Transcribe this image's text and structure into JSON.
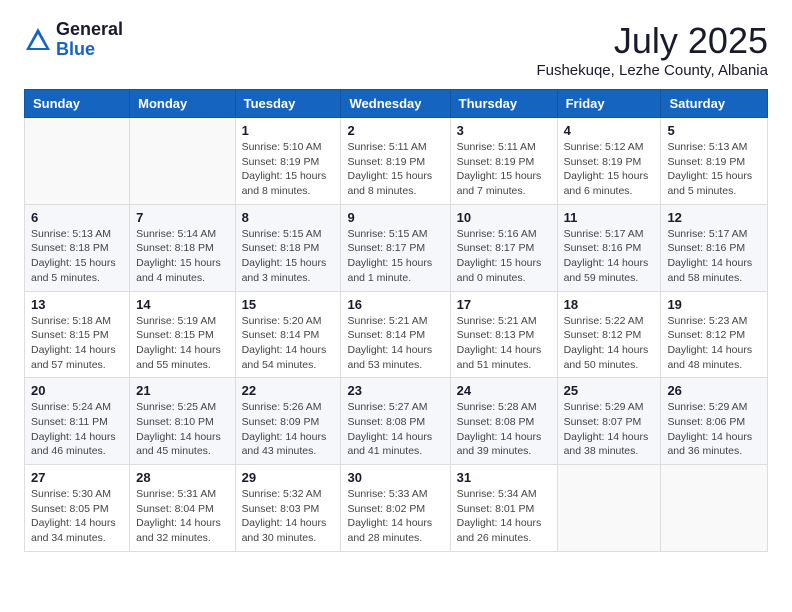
{
  "header": {
    "logo_general": "General",
    "logo_blue": "Blue",
    "month_title": "July 2025",
    "location": "Fushekuqe, Lezhe County, Albania"
  },
  "weekdays": [
    "Sunday",
    "Monday",
    "Tuesday",
    "Wednesday",
    "Thursday",
    "Friday",
    "Saturday"
  ],
  "weeks": [
    [
      {
        "day": "",
        "sunrise": "",
        "sunset": "",
        "daylight": ""
      },
      {
        "day": "",
        "sunrise": "",
        "sunset": "",
        "daylight": ""
      },
      {
        "day": "1",
        "sunrise": "Sunrise: 5:10 AM",
        "sunset": "Sunset: 8:19 PM",
        "daylight": "Daylight: 15 hours and 8 minutes."
      },
      {
        "day": "2",
        "sunrise": "Sunrise: 5:11 AM",
        "sunset": "Sunset: 8:19 PM",
        "daylight": "Daylight: 15 hours and 8 minutes."
      },
      {
        "day": "3",
        "sunrise": "Sunrise: 5:11 AM",
        "sunset": "Sunset: 8:19 PM",
        "daylight": "Daylight: 15 hours and 7 minutes."
      },
      {
        "day": "4",
        "sunrise": "Sunrise: 5:12 AM",
        "sunset": "Sunset: 8:19 PM",
        "daylight": "Daylight: 15 hours and 6 minutes."
      },
      {
        "day": "5",
        "sunrise": "Sunrise: 5:13 AM",
        "sunset": "Sunset: 8:19 PM",
        "daylight": "Daylight: 15 hours and 5 minutes."
      }
    ],
    [
      {
        "day": "6",
        "sunrise": "Sunrise: 5:13 AM",
        "sunset": "Sunset: 8:18 PM",
        "daylight": "Daylight: 15 hours and 5 minutes."
      },
      {
        "day": "7",
        "sunrise": "Sunrise: 5:14 AM",
        "sunset": "Sunset: 8:18 PM",
        "daylight": "Daylight: 15 hours and 4 minutes."
      },
      {
        "day": "8",
        "sunrise": "Sunrise: 5:15 AM",
        "sunset": "Sunset: 8:18 PM",
        "daylight": "Daylight: 15 hours and 3 minutes."
      },
      {
        "day": "9",
        "sunrise": "Sunrise: 5:15 AM",
        "sunset": "Sunset: 8:17 PM",
        "daylight": "Daylight: 15 hours and 1 minute."
      },
      {
        "day": "10",
        "sunrise": "Sunrise: 5:16 AM",
        "sunset": "Sunset: 8:17 PM",
        "daylight": "Daylight: 15 hours and 0 minutes."
      },
      {
        "day": "11",
        "sunrise": "Sunrise: 5:17 AM",
        "sunset": "Sunset: 8:16 PM",
        "daylight": "Daylight: 14 hours and 59 minutes."
      },
      {
        "day": "12",
        "sunrise": "Sunrise: 5:17 AM",
        "sunset": "Sunset: 8:16 PM",
        "daylight": "Daylight: 14 hours and 58 minutes."
      }
    ],
    [
      {
        "day": "13",
        "sunrise": "Sunrise: 5:18 AM",
        "sunset": "Sunset: 8:15 PM",
        "daylight": "Daylight: 14 hours and 57 minutes."
      },
      {
        "day": "14",
        "sunrise": "Sunrise: 5:19 AM",
        "sunset": "Sunset: 8:15 PM",
        "daylight": "Daylight: 14 hours and 55 minutes."
      },
      {
        "day": "15",
        "sunrise": "Sunrise: 5:20 AM",
        "sunset": "Sunset: 8:14 PM",
        "daylight": "Daylight: 14 hours and 54 minutes."
      },
      {
        "day": "16",
        "sunrise": "Sunrise: 5:21 AM",
        "sunset": "Sunset: 8:14 PM",
        "daylight": "Daylight: 14 hours and 53 minutes."
      },
      {
        "day": "17",
        "sunrise": "Sunrise: 5:21 AM",
        "sunset": "Sunset: 8:13 PM",
        "daylight": "Daylight: 14 hours and 51 minutes."
      },
      {
        "day": "18",
        "sunrise": "Sunrise: 5:22 AM",
        "sunset": "Sunset: 8:12 PM",
        "daylight": "Daylight: 14 hours and 50 minutes."
      },
      {
        "day": "19",
        "sunrise": "Sunrise: 5:23 AM",
        "sunset": "Sunset: 8:12 PM",
        "daylight": "Daylight: 14 hours and 48 minutes."
      }
    ],
    [
      {
        "day": "20",
        "sunrise": "Sunrise: 5:24 AM",
        "sunset": "Sunset: 8:11 PM",
        "daylight": "Daylight: 14 hours and 46 minutes."
      },
      {
        "day": "21",
        "sunrise": "Sunrise: 5:25 AM",
        "sunset": "Sunset: 8:10 PM",
        "daylight": "Daylight: 14 hours and 45 minutes."
      },
      {
        "day": "22",
        "sunrise": "Sunrise: 5:26 AM",
        "sunset": "Sunset: 8:09 PM",
        "daylight": "Daylight: 14 hours and 43 minutes."
      },
      {
        "day": "23",
        "sunrise": "Sunrise: 5:27 AM",
        "sunset": "Sunset: 8:08 PM",
        "daylight": "Daylight: 14 hours and 41 minutes."
      },
      {
        "day": "24",
        "sunrise": "Sunrise: 5:28 AM",
        "sunset": "Sunset: 8:08 PM",
        "daylight": "Daylight: 14 hours and 39 minutes."
      },
      {
        "day": "25",
        "sunrise": "Sunrise: 5:29 AM",
        "sunset": "Sunset: 8:07 PM",
        "daylight": "Daylight: 14 hours and 38 minutes."
      },
      {
        "day": "26",
        "sunrise": "Sunrise: 5:29 AM",
        "sunset": "Sunset: 8:06 PM",
        "daylight": "Daylight: 14 hours and 36 minutes."
      }
    ],
    [
      {
        "day": "27",
        "sunrise": "Sunrise: 5:30 AM",
        "sunset": "Sunset: 8:05 PM",
        "daylight": "Daylight: 14 hours and 34 minutes."
      },
      {
        "day": "28",
        "sunrise": "Sunrise: 5:31 AM",
        "sunset": "Sunset: 8:04 PM",
        "daylight": "Daylight: 14 hours and 32 minutes."
      },
      {
        "day": "29",
        "sunrise": "Sunrise: 5:32 AM",
        "sunset": "Sunset: 8:03 PM",
        "daylight": "Daylight: 14 hours and 30 minutes."
      },
      {
        "day": "30",
        "sunrise": "Sunrise: 5:33 AM",
        "sunset": "Sunset: 8:02 PM",
        "daylight": "Daylight: 14 hours and 28 minutes."
      },
      {
        "day": "31",
        "sunrise": "Sunrise: 5:34 AM",
        "sunset": "Sunset: 8:01 PM",
        "daylight": "Daylight: 14 hours and 26 minutes."
      },
      {
        "day": "",
        "sunrise": "",
        "sunset": "",
        "daylight": ""
      },
      {
        "day": "",
        "sunrise": "",
        "sunset": "",
        "daylight": ""
      }
    ]
  ]
}
